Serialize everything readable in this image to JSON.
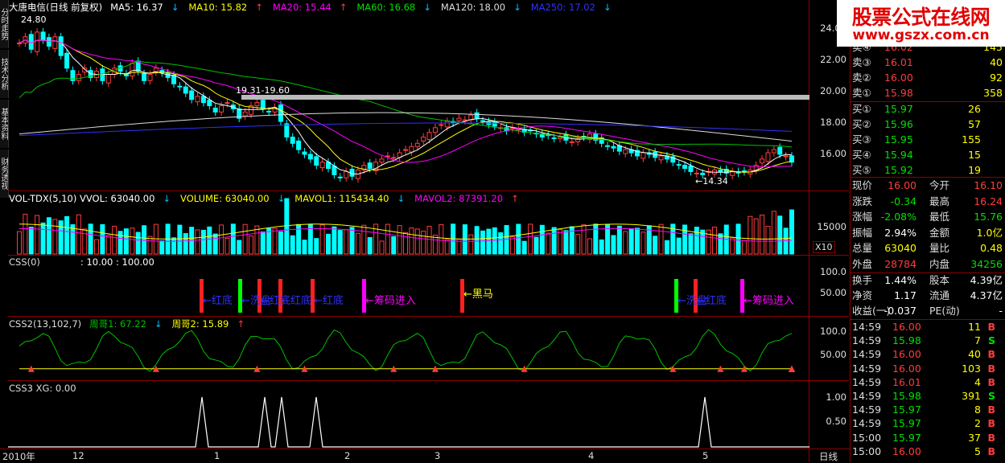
{
  "main_panel": {
    "stock": "大唐电信(日线 前复权)",
    "ma": [
      {
        "label": "MA5: 16.37",
        "arrow": "↓",
        "color": "#ffffff"
      },
      {
        "label": "MA10: 15.82",
        "arrow": "↑",
        "color": "#ffff00"
      },
      {
        "label": "MA20: 15.44",
        "arrow": "↑",
        "color": "#ff00ff"
      },
      {
        "label": "MA60: 16.68",
        "arrow": "↓",
        "color": "#00e000"
      },
      {
        "label": "MA120: 18.00",
        "arrow": "↓",
        "color": "#dddddd"
      },
      {
        "label": "MA250: 17.02",
        "arrow": "↓",
        "color": "#3030ff"
      }
    ],
    "annotations": {
      "high": "24.80",
      "range": "19.31-19.60",
      "low": "←14.34"
    },
    "y_labels": [
      "24.00",
      "22.00",
      "20.00",
      "18.00",
      "16.00"
    ]
  },
  "vol_panel": {
    "title": [
      {
        "label": "VOL-TDX(5,10)  VVOL: 63040.00",
        "arrow": "↓",
        "color": "#ffffff"
      },
      {
        "label": "VOLUME: 63040.00",
        "arrow": "↓",
        "color": "#ffff00"
      },
      {
        "label": "MAVOL1: 115434.40",
        "arrow": "↓",
        "color": "#ffff00"
      },
      {
        "label": "MAVOL2: 87391.20",
        "arrow": "↑",
        "color": "#ff00ff"
      }
    ],
    "y_label": "15000",
    "unit": "X10"
  },
  "css_panel": {
    "title": "CSS(0)",
    "params": ": 10.00 : 100.00",
    "y_labels": [
      "100.0",
      "50.00"
    ],
    "signals": [
      {
        "text": "红底",
        "color": "#3030ff"
      },
      {
        "text": "洗盘",
        "color": "#3030ff"
      },
      {
        "text": "红底",
        "color": "#3030ff"
      },
      {
        "text": "红底",
        "color": "#3030ff"
      },
      {
        "text": "红底",
        "color": "#3030ff"
      },
      {
        "text": "筹码进入",
        "color": "#ff00ff"
      },
      {
        "text": "黑马",
        "color": "#ffff00"
      },
      {
        "text": "洗盘",
        "color": "#3030ff"
      },
      {
        "text": "红底",
        "color": "#3030ff"
      },
      {
        "text": "筹码进入",
        "color": "#ff00ff"
      }
    ]
  },
  "css2_panel": {
    "title": "CSS2(13,102,7)",
    "lines": [
      {
        "label": "周哥1: 67.22",
        "arrow": "↓",
        "color": "#00c000"
      },
      {
        "label": "周哥2: 15.89",
        "arrow": "↑",
        "color": "#ffff00"
      }
    ],
    "y_labels": [
      "100.0",
      "50.00"
    ]
  },
  "css3_panel": {
    "title": "CSS3  XG: 0.00",
    "y_labels": [
      "1.00",
      "0.50"
    ]
  },
  "x_axis": {
    "labels": [
      "2010年",
      "12",
      "1",
      "2",
      "3",
      "4",
      "5"
    ],
    "period": "日线"
  },
  "left_tabs": [
    "分时走势",
    "技术分析",
    "基本资料",
    "财务透视"
  ],
  "quote": {
    "watermark_title": "股票公式在线网",
    "watermark_url": "www.gszx.com.cn",
    "asks": [
      {
        "label": "卖④",
        "price": "16.02",
        "vol": "145"
      },
      {
        "label": "卖③",
        "price": "16.01",
        "vol": "40"
      },
      {
        "label": "卖②",
        "price": "16.00",
        "vol": "92"
      },
      {
        "label": "卖①",
        "price": "15.98",
        "vol": "358"
      }
    ],
    "bids": [
      {
        "label": "买①",
        "price": "15.97",
        "vol": "26"
      },
      {
        "label": "买②",
        "price": "15.96",
        "vol": "57"
      },
      {
        "label": "买③",
        "price": "15.95",
        "vol": "155"
      },
      {
        "label": "买④",
        "price": "15.94",
        "vol": "15"
      },
      {
        "label": "买⑤",
        "price": "15.92",
        "vol": "19"
      }
    ],
    "stats": [
      {
        "l1": "现价",
        "v1": "16.00",
        "c1": "red",
        "l2": "今开",
        "v2": "16.10",
        "c2": "red"
      },
      {
        "l1": "涨跌",
        "v1": "-0.34",
        "c1": "grn",
        "l2": "最高",
        "v2": "16.24",
        "c2": "red"
      },
      {
        "l1": "涨幅",
        "v1": "-2.08%",
        "c1": "grn",
        "l2": "最低",
        "v2": "15.76",
        "c2": "grn"
      },
      {
        "l1": "振幅",
        "v1": "2.94%",
        "c1": "wht",
        "l2": "金额",
        "v2": "1.0亿",
        "c2": "yel"
      },
      {
        "l1": "总量",
        "v1": "63040",
        "c1": "yel",
        "l2": "量比",
        "v2": "0.48",
        "c2": "yel"
      },
      {
        "l1": "外盘",
        "v1": "28784",
        "c1": "red",
        "l2": "内盘",
        "v2": "34256",
        "c2": "grn"
      }
    ],
    "stats2": [
      {
        "l1": "换手",
        "v1": "1.44%",
        "l2": "股本",
        "v2": "4.39亿"
      },
      {
        "l1": "净资",
        "v1": "1.17",
        "l2": "流通",
        "v2": "4.37亿"
      },
      {
        "l1": "收益(一)",
        "v1": "-0.037",
        "l2": "PE(动)",
        "v2": "-"
      }
    ],
    "ticks": [
      {
        "t": "14:59",
        "p": "16.00",
        "pc": "red",
        "v": "11",
        "s": "B"
      },
      {
        "t": "14:59",
        "p": "15.98",
        "pc": "grn",
        "v": "7",
        "s": "S"
      },
      {
        "t": "14:59",
        "p": "16.00",
        "pc": "red",
        "v": "40",
        "s": "B"
      },
      {
        "t": "14:59",
        "p": "16.00",
        "pc": "red",
        "v": "103",
        "s": "B"
      },
      {
        "t": "14:59",
        "p": "16.01",
        "pc": "red",
        "v": "4",
        "s": "B"
      },
      {
        "t": "14:59",
        "p": "15.98",
        "pc": "grn",
        "v": "391",
        "s": "S"
      },
      {
        "t": "14:59",
        "p": "15.97",
        "pc": "grn",
        "v": "8",
        "s": "B"
      },
      {
        "t": "14:59",
        "p": "15.97",
        "pc": "grn",
        "v": "2",
        "s": "B"
      },
      {
        "t": "15:00",
        "p": "15.97",
        "pc": "grn",
        "v": "37",
        "s": "B"
      },
      {
        "t": "15:00",
        "p": "16.00",
        "pc": "red",
        "v": "5",
        "s": "B"
      }
    ]
  }
}
